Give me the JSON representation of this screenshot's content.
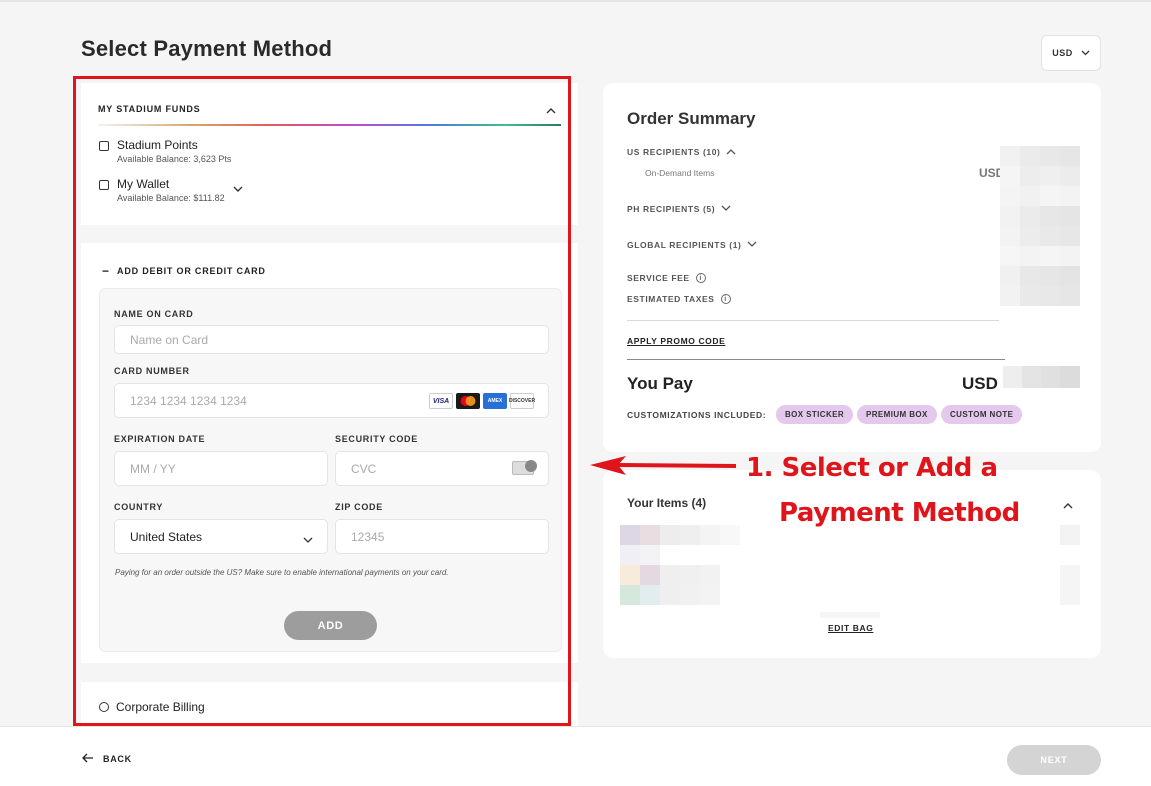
{
  "page": {
    "title": "Select Payment Method",
    "currency": "USD"
  },
  "funds": {
    "header": "MY STADIUM FUNDS",
    "points_label": "Stadium Points",
    "points_balance": "Available Balance: 3,623 Pts",
    "wallet_label": "My Wallet",
    "wallet_balance": "Available Balance: $111.82"
  },
  "card": {
    "header": "ADD DEBIT OR CREDIT CARD",
    "name_label": "NAME ON CARD",
    "name_placeholder": "Name on Card",
    "number_label": "CARD NUMBER",
    "number_placeholder": "1234 1234 1234 1234",
    "expiry_label": "EXPIRATION DATE",
    "expiry_placeholder": "MM / YY",
    "cvc_label": "SECURITY CODE",
    "cvc_placeholder": "CVC",
    "country_label": "COUNTRY",
    "country_value": "United States",
    "zip_label": "ZIP CODE",
    "zip_placeholder": "12345",
    "intl_note": "Paying for an order outside the US? Make sure to enable international payments on your card.",
    "add_label": "ADD",
    "brands": [
      "VISA",
      "",
      "AMEX",
      "DISCOVER"
    ]
  },
  "corporate": {
    "label": "Corporate Billing"
  },
  "summary": {
    "title": "Order Summary",
    "us_recipients": "US RECIPIENTS (10)",
    "on_demand": "On-Demand Items",
    "usd_partial": "USD",
    "ph_recipients": "PH RECIPIENTS (5)",
    "global_recipients": "GLOBAL RECIPIENTS (1)",
    "service_fee": "SERVICE FEE",
    "estimated_taxes": "ESTIMATED TAXES",
    "promo": "APPLY PROMO CODE",
    "you_pay": "You Pay",
    "total_currency": "USD",
    "customizations_label": "CUSTOMIZATIONS INCLUDED:",
    "badges": [
      "BOX STICKER",
      "PREMIUM BOX",
      "CUSTOM NOTE"
    ],
    "info_glyph": "i"
  },
  "items": {
    "title": "Your Items (4)",
    "edit_bag": "EDIT BAG"
  },
  "annotation": {
    "line1": "1. Select or Add a",
    "line2": "Payment Method",
    "color": "#e0151b"
  },
  "footer": {
    "back": "BACK",
    "next": "NEXT"
  }
}
